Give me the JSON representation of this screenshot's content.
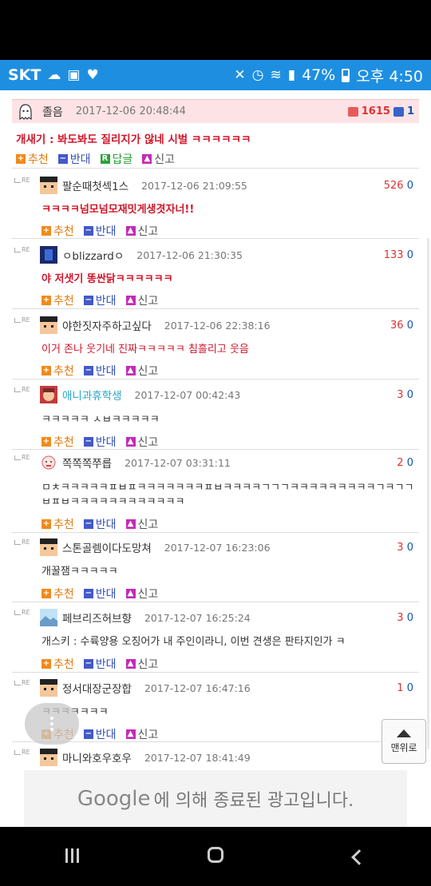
{
  "status_bar": {
    "carrier": "SKT",
    "battery": "47%",
    "time": "오후 4:50"
  },
  "post": {
    "nick": "졸음",
    "date": "2017-12-06 20:48:44",
    "up": "1615",
    "down": "1",
    "text": "개새기 : 봐도봐도 질리지가 않네 시벌 ㅋㅋㅋㅋㅋㅋ",
    "actions": {
      "recommend": "추천",
      "oppose": "반대",
      "reply": "답글",
      "report": "신고"
    }
  },
  "actions": {
    "recommend": "추천",
    "oppose": "반대",
    "report": "신고"
  },
  "comments": [
    {
      "nick": "팔순때첫섹1스",
      "date": "2017-12-06 21:09:55",
      "up": "526",
      "down": "0",
      "text": "ㅋㅋㅋㅋ넘모넘모재밋게생겻자너!!"
    },
    {
      "nick": "ㅇblizzardㅇ",
      "date": "2017-12-06 21:30:35",
      "up": "133",
      "down": "0",
      "text": "야 저샛기 똥싼닭ㅋㅋㅋㅋㅋㅋ"
    },
    {
      "nick": "야한짓자주하고싶다",
      "date": "2017-12-06 22:38:16",
      "up": "36",
      "down": "0",
      "text": "이거 존나 웃기네 진짜ㅋㅋㅋㅋㅋ 침흘리고 웃음"
    },
    {
      "nick": "애니과휴학생",
      "date": "2017-12-07 00:42:43",
      "up": "3",
      "down": "0",
      "text": "ㅋㅋㅋㅋㅋ ㅅㅂㅋㅋㅋㅋㅋ"
    },
    {
      "nick": "쪽쪽쪽쭈릅",
      "date": "2017-12-07 03:31:11",
      "up": "2",
      "down": "0",
      "text": "ㅁㅊㅋㅋㅋㅋㅋㅍㅂㅍㅋㅋㅋㅋㅋㅋㅋㅍㅂㅋㅋㅋㅋㄱㄱㄱㅋㅋㅋㅋㅋㅋㅋㅋㅋㄱㅋㄱㄱㅂㅍㅂㅋㅋㅋㅋㅋㅋㅋㅋㅋㅋㅋㅋ"
    },
    {
      "nick": "스톤골렘이다도망쳐",
      "date": "2017-12-07 16:23:06",
      "up": "3",
      "down": "0",
      "text": "개꿀잼ㅋㅋㅋㅋㅋ"
    },
    {
      "nick": "페브리즈허브향",
      "date": "2017-12-07 16:25:24",
      "up": "3",
      "down": "0",
      "text": "개스키 : 수륙양용 오징어가 내 주인이라니, 이번 견생은 판타지인가 ㅋ"
    },
    {
      "nick": "정서대장군장합",
      "date": "2017-12-07 16:47:16",
      "up": "1",
      "down": "0",
      "text": "ㅋㅋㅋㅋㅋㅋㅋ"
    },
    {
      "nick": "마니와호우호우",
      "date": "2017-12-07 18:41:49",
      "up": "0",
      "down": "0",
      "text": ""
    }
  ],
  "top_button": "맨위로",
  "ad_notice": {
    "brand": "Google",
    "text": "에 의해 종료된 광고입니다."
  },
  "colors": {
    "status_bar": "#1e8fe0",
    "highlight": "#fde3e5",
    "red_text": "#d0162a",
    "recommend": "#f08a1c",
    "oppose": "#4459c9"
  }
}
